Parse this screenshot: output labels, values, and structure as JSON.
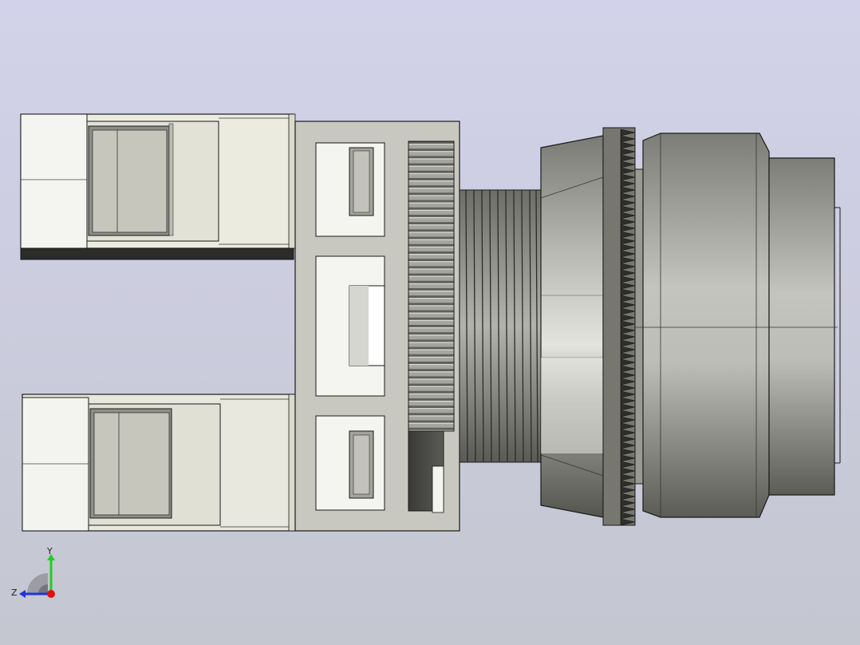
{
  "view": {
    "background_top": "#d2d2ea",
    "background_bottom": "#c4c6d0"
  },
  "triad": {
    "y_label": "Y",
    "z_label": "Z",
    "y_color": "#22cc22",
    "z_color": "#2233dd",
    "x_color": "#dd1111"
  },
  "model": {
    "body_color": "#c7c6c0",
    "metal_color": "#8f8f8a",
    "edge_color": "#1a1a1a"
  }
}
